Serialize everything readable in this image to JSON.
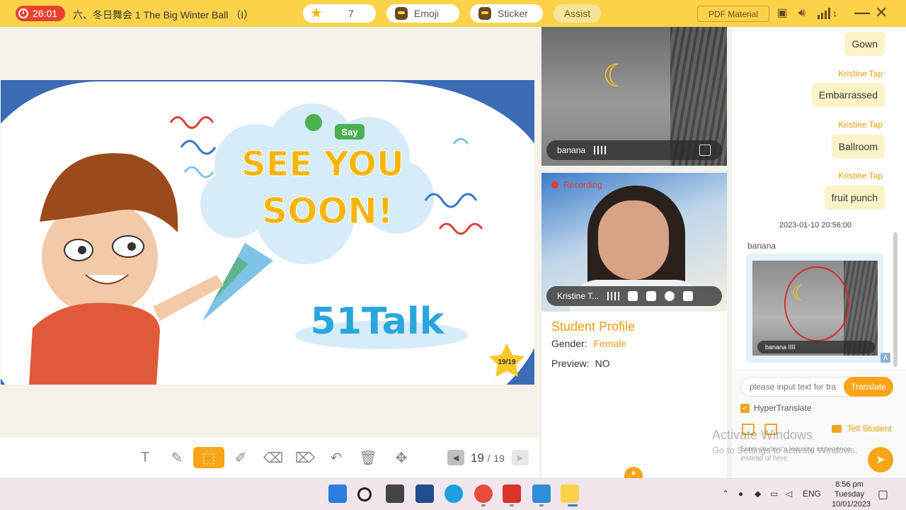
{
  "topbar": {
    "timer": "26:01",
    "lesson_title": "六、冬日舞会 1 The Big Winter Ball （I）",
    "stars": "7",
    "emoji_label": "Emoji",
    "sticker_label": "Sticker",
    "assist_label": "Assist",
    "pdf_label": "PDF Material",
    "signal_num": "1"
  },
  "slide": {
    "say_label": "Say",
    "headline_1": "SEE YOU",
    "headline_2": "SOON!",
    "brand": "51Talk",
    "page_badge": "19/19"
  },
  "pager": {
    "current": "19",
    "separator": "/",
    "total": "19"
  },
  "video_student": {
    "name": "banana"
  },
  "video_teacher": {
    "name": "Kristine T...",
    "recording": "Recording"
  },
  "profile": {
    "title": "Student Profile",
    "gender_label": "Gender:",
    "gender_value": "Female",
    "preview_label": "Preview:",
    "preview_value": "NO"
  },
  "chat": {
    "messages": [
      {
        "sender": "",
        "text": "Gown"
      },
      {
        "sender": "Kristine Tap",
        "text": "Embarrassed"
      },
      {
        "sender": "Kristine Tap",
        "text": "Ballroom"
      },
      {
        "sender": "Kristine Tap",
        "text": "fruit punch"
      }
    ],
    "date": "2023-01-10 20:56:00",
    "image_sender": "banana",
    "image_caption": "banana",
    "input_placeholder": "please input text for tra",
    "translate_label": "Translate",
    "hyper_label": "HyperTranslate",
    "tell_label": "Tell Student",
    "message_hint": "Enter student's learning experience instead of here."
  },
  "watermark": {
    "line1": "Activate Windows",
    "line2": "Go to Settings to activate Windows."
  },
  "taskbar": {
    "lang": "ENG",
    "time": "8:56 pm",
    "day": "Tuesday",
    "date": "10/01/2023"
  },
  "colors": {
    "accent": "#f9a517",
    "topbar": "#fbd34b",
    "slide_blue": "#3b6bb5",
    "recording": "#e53935"
  }
}
